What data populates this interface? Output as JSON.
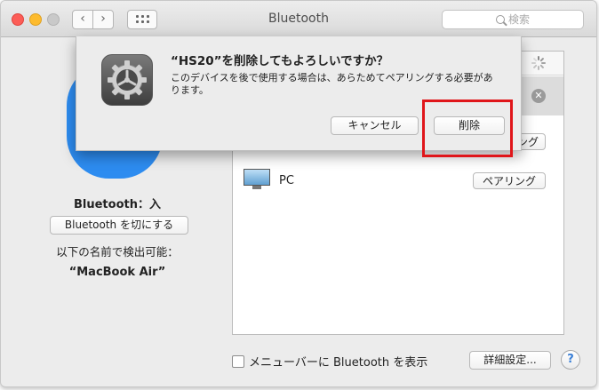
{
  "window": {
    "title": "Bluetooth"
  },
  "toolbar": {
    "back_glyph": "‹",
    "forward_glyph": "›"
  },
  "search": {
    "placeholder": "検索"
  },
  "sidebar": {
    "status": "Bluetooth：入",
    "turn_off_button": "Bluetooth を切にする",
    "discoverable_label": "以下の名前で検出可能：",
    "device_name": "“MacBook Air”"
  },
  "device_list": {
    "devices": [
      {
        "name": "PC",
        "pair_button": "ペアリング"
      }
    ],
    "partial_pair_label": "リング"
  },
  "footer": {
    "show_in_menubar_label": "メニューバーに Bluetooth を表示",
    "advanced_button": "詳細設定...",
    "help_button": "?"
  },
  "dialog": {
    "title": "“HS20”を削除してもよろしいですか？",
    "message": "このデバイスを後で使用する場合は、あらためてペアリングする必要があります。",
    "cancel_button": "キャンセル",
    "delete_button": "削除"
  },
  "icons": {
    "window": [
      "close-icon",
      "minimize-icon",
      "zoom-icon",
      "grid-icon",
      "search-icon"
    ],
    "content": [
      "bluetooth-icon",
      "spinner-icon",
      "remove-icon",
      "monitor-icon",
      "gear-icon"
    ]
  },
  "colors": {
    "highlight": "#e0161a",
    "bluetooth_blue": "#2d8cf0",
    "traffic_close": "#fc5d57",
    "traffic_min": "#fdbb2e"
  }
}
